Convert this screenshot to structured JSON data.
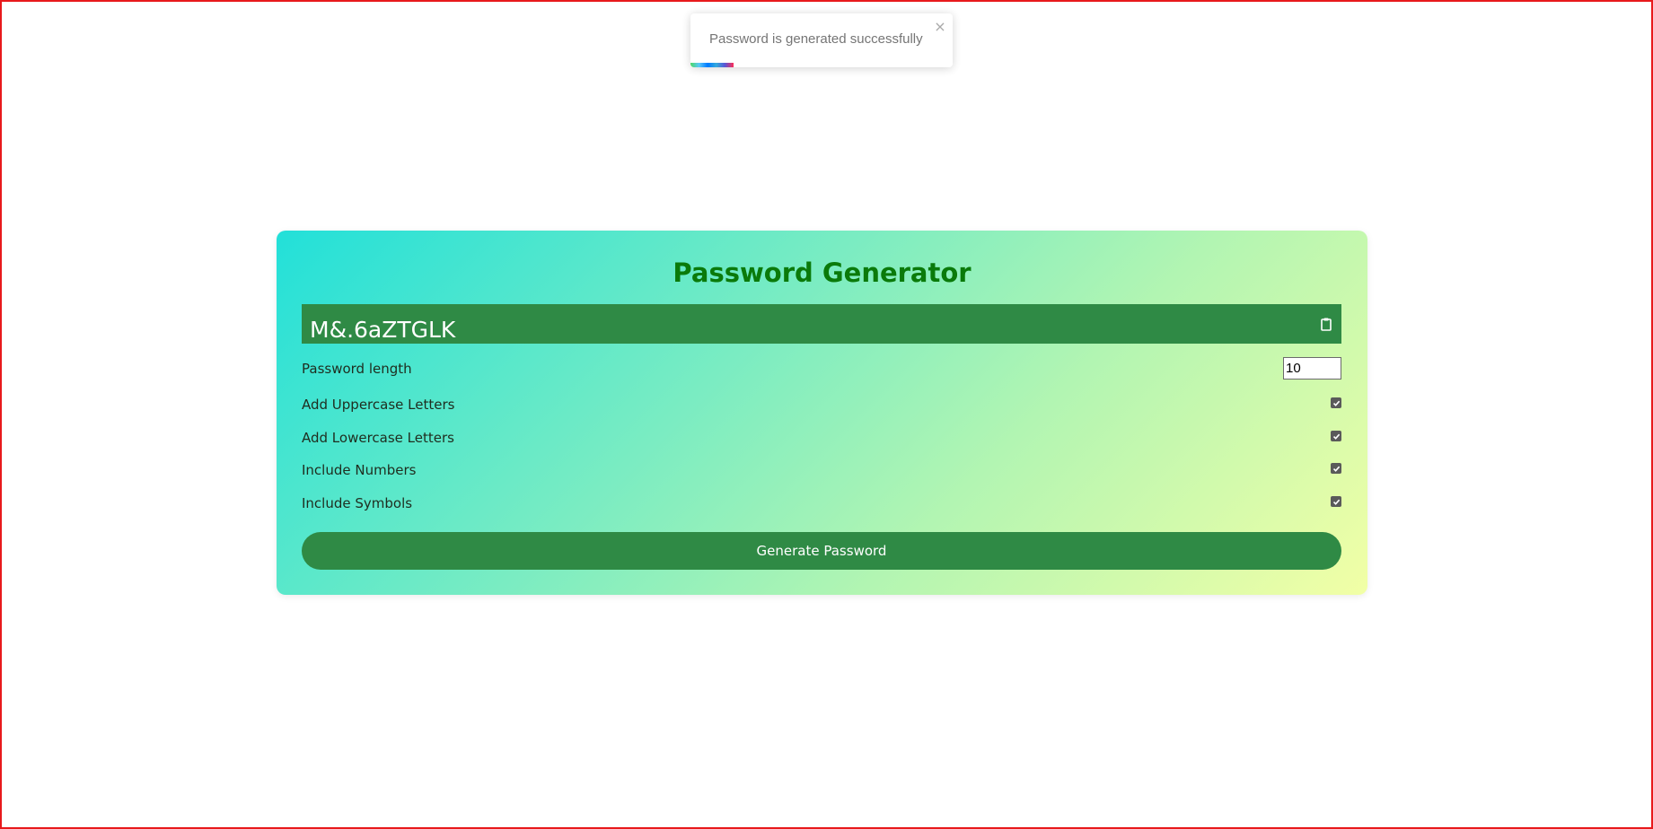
{
  "toast": {
    "message": "Password is generated successfully",
    "close_glyph": "×",
    "progress_fraction": 0.165,
    "progress_colors": [
      "#4cd964",
      "#5ac8fa",
      "#007aff",
      "#34aadc",
      "#5856d6",
      "#ff2d55"
    ]
  },
  "card": {
    "title": "Password Generator",
    "password": "M&.6aZTGLK",
    "copy_icon": "clipboard-icon",
    "length": {
      "label": "Password length",
      "value": "10"
    },
    "options": [
      {
        "label": "Add Uppercase Letters",
        "checked": true
      },
      {
        "label": "Add Lowercase Letters",
        "checked": true
      },
      {
        "label": "Include Numbers",
        "checked": true
      },
      {
        "label": "Include Symbols",
        "checked": true
      }
    ],
    "generate_label": "Generate Password"
  },
  "colors": {
    "accent_green": "#2f8a45",
    "title_green": "#0a7a0a",
    "frame_border": "#e8191c",
    "gradient_start": "#22e0d9",
    "gradient_end": "#f2ffa6"
  }
}
